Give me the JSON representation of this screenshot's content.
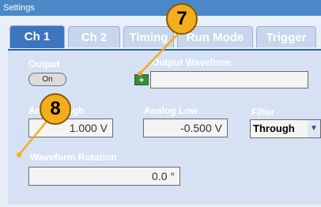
{
  "window": {
    "title": "Settings"
  },
  "tabs": [
    {
      "label": "Ch 1"
    },
    {
      "label": "Ch 2"
    },
    {
      "label": "Timing"
    },
    {
      "label": "Run Mode"
    },
    {
      "label": "Trigger"
    }
  ],
  "output": {
    "label": "Output",
    "button": "On"
  },
  "output_waveform": {
    "label": "Output Waveform",
    "value": ""
  },
  "analog_high": {
    "label": "Analog High",
    "value": "1.000 V"
  },
  "analog_low": {
    "label": "Analog Low",
    "value": "-0.500 V"
  },
  "filter": {
    "label": "Filter",
    "value": "Through"
  },
  "waveform_rotation": {
    "label": "Waveform Rotation",
    "value": "0.0 °"
  },
  "callouts": {
    "seven": "7",
    "eight": "8"
  },
  "colors": {
    "title_bar": "#4a88c8",
    "active_tab": "#3f74bf",
    "callout": "#f4ad1c"
  }
}
